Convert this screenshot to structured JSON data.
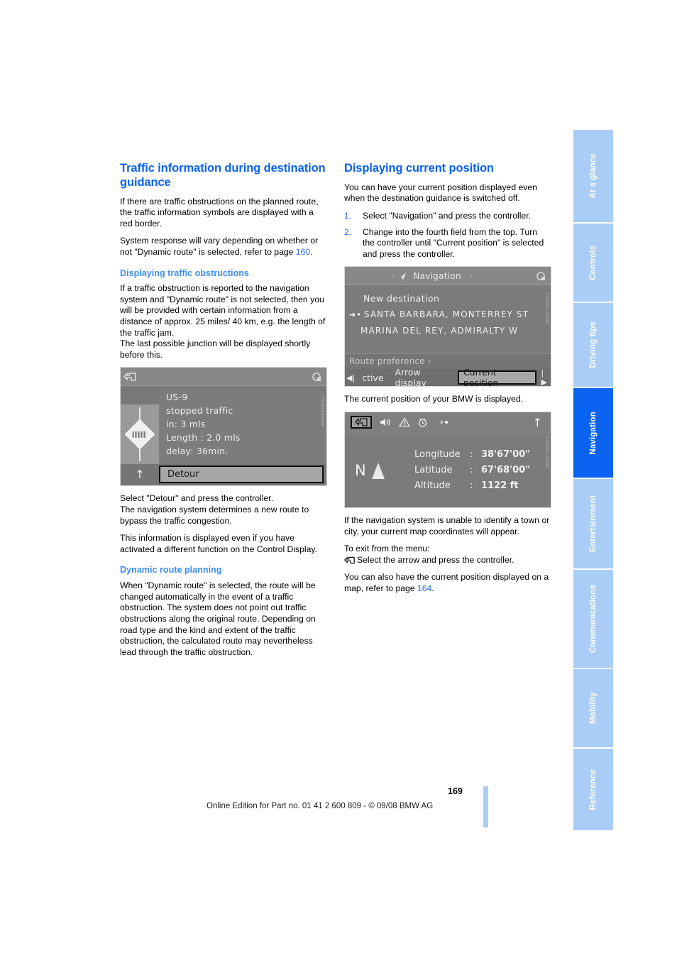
{
  "page": {
    "number": "169",
    "footer_text": "Online Edition for Part no. 01 41 2 600 809 - © 09/08 BMW AG"
  },
  "tabs": [
    {
      "label": "At a glance",
      "active": false
    },
    {
      "label": "Controls",
      "active": false
    },
    {
      "label": "Driving tips",
      "active": false
    },
    {
      "label": "Navigation",
      "active": true
    },
    {
      "label": "Entertainment",
      "active": false
    },
    {
      "label": "Communications",
      "active": false
    },
    {
      "label": "Mobility",
      "active": false
    },
    {
      "label": "Reference",
      "active": false
    }
  ],
  "left_column": {
    "heading": "Traffic information during destination guidance",
    "para1": "If there are traffic obstructions on the planned route, the traffic information symbols are displayed with a red border.",
    "para2_before": "System response will vary depending on whether or not \"Dynamic route\" is selected, refer to page ",
    "para2_ref": "160",
    "para2_after": ".",
    "subheading1": "Displaying traffic obstructions",
    "para3": "If a traffic obstruction is reported to the navigation system and \"Dynamic route\" is not selected, then you will be provided with certain information from a distance of approx. 25 miles/ 40 km, e.g. the length of the traffic jam.",
    "para3b": "The last possible junction will be displayed shortly before this.",
    "para4": "Select \"Detour\" and press the controller.",
    "para4b": "The navigation system determines a new route to bypass the traffic congestion.",
    "para5": "This information is displayed even if you have activated a different function on the Control Display.",
    "subheading2": "Dynamic route planning",
    "para6": "When \"Dynamic route\" is selected, the route will be changed automatically in the event of a traffic obstruction. The system does not point out traffic obstructions along the original route. Depending on road type and the kind and extent of the traffic obstruction, the calculated route may nevertheless lead through the traffic obstruction."
  },
  "right_column": {
    "heading": "Displaying current position",
    "para1": "You can have your current position displayed even when the destination guidance is switched off.",
    "steps": [
      {
        "num": "1.",
        "text": "Select \"Navigation\" and press the controller."
      },
      {
        "num": "2.",
        "text": "Change into the fourth field from the top. Turn the controller until \"Current position\" is selected and press the controller."
      }
    ],
    "para2": "The current position of your BMW is displayed.",
    "para3": "If the navigation system is unable to identify a town or city, your current map coordinates will appear.",
    "para4": "To exit from the menu:",
    "para5": "Select the arrow and press the controller.",
    "para6_before": "You can also have the current position displayed on a map, refer to page ",
    "para6_ref": "164",
    "para6_after": "."
  },
  "traffic_display": {
    "back_icon": "back-arrow-icon",
    "settings_icon": "gear-icon",
    "road": "US-9",
    "condition": "stopped traffic",
    "distance": "in: 3 mls",
    "length": "Length : 2.0 mls",
    "delay": "delay: 36min.",
    "button": "Detour",
    "figcode": "NT00891-00046"
  },
  "nav_menu_display": {
    "title": "Navigation",
    "left_arrow": "‹",
    "right_arrow": "›",
    "title_icon": "navigation-arrow-icon",
    "settings_icon": "gear-icon",
    "items": [
      {
        "label": "New destination",
        "marked": false
      },
      {
        "label": "SANTA BARBARA, MONTERREY ST",
        "marked": true
      },
      {
        "label": "MARINA DEL REY, ADMIRALTY W",
        "marked": false
      }
    ],
    "route_preference": "Route preference ›",
    "bottom_left_edge": "◀|",
    "bottom_options": [
      "ctive",
      "Arrow display",
      "Current position"
    ],
    "selected_option": "Current position",
    "bottom_right_edge": "|▶",
    "figcode": "NT00891-00046"
  },
  "position_display": {
    "icons": [
      "back-arrow-icon",
      "speaker-icon",
      "warning-icon",
      "clock-icon",
      "route-arrow-icon"
    ],
    "up_arrow": "↑",
    "compass_letter": "N",
    "rows": [
      {
        "key": "Longitude",
        "sep": ":",
        "value": "38'67'00\""
      },
      {
        "key": "Latitude",
        "sep": ":",
        "value": "67'68'00\""
      },
      {
        "key": "Altitude",
        "sep": ":",
        "value": "1122 ft"
      }
    ],
    "figcode": "NT00891-00046"
  }
}
